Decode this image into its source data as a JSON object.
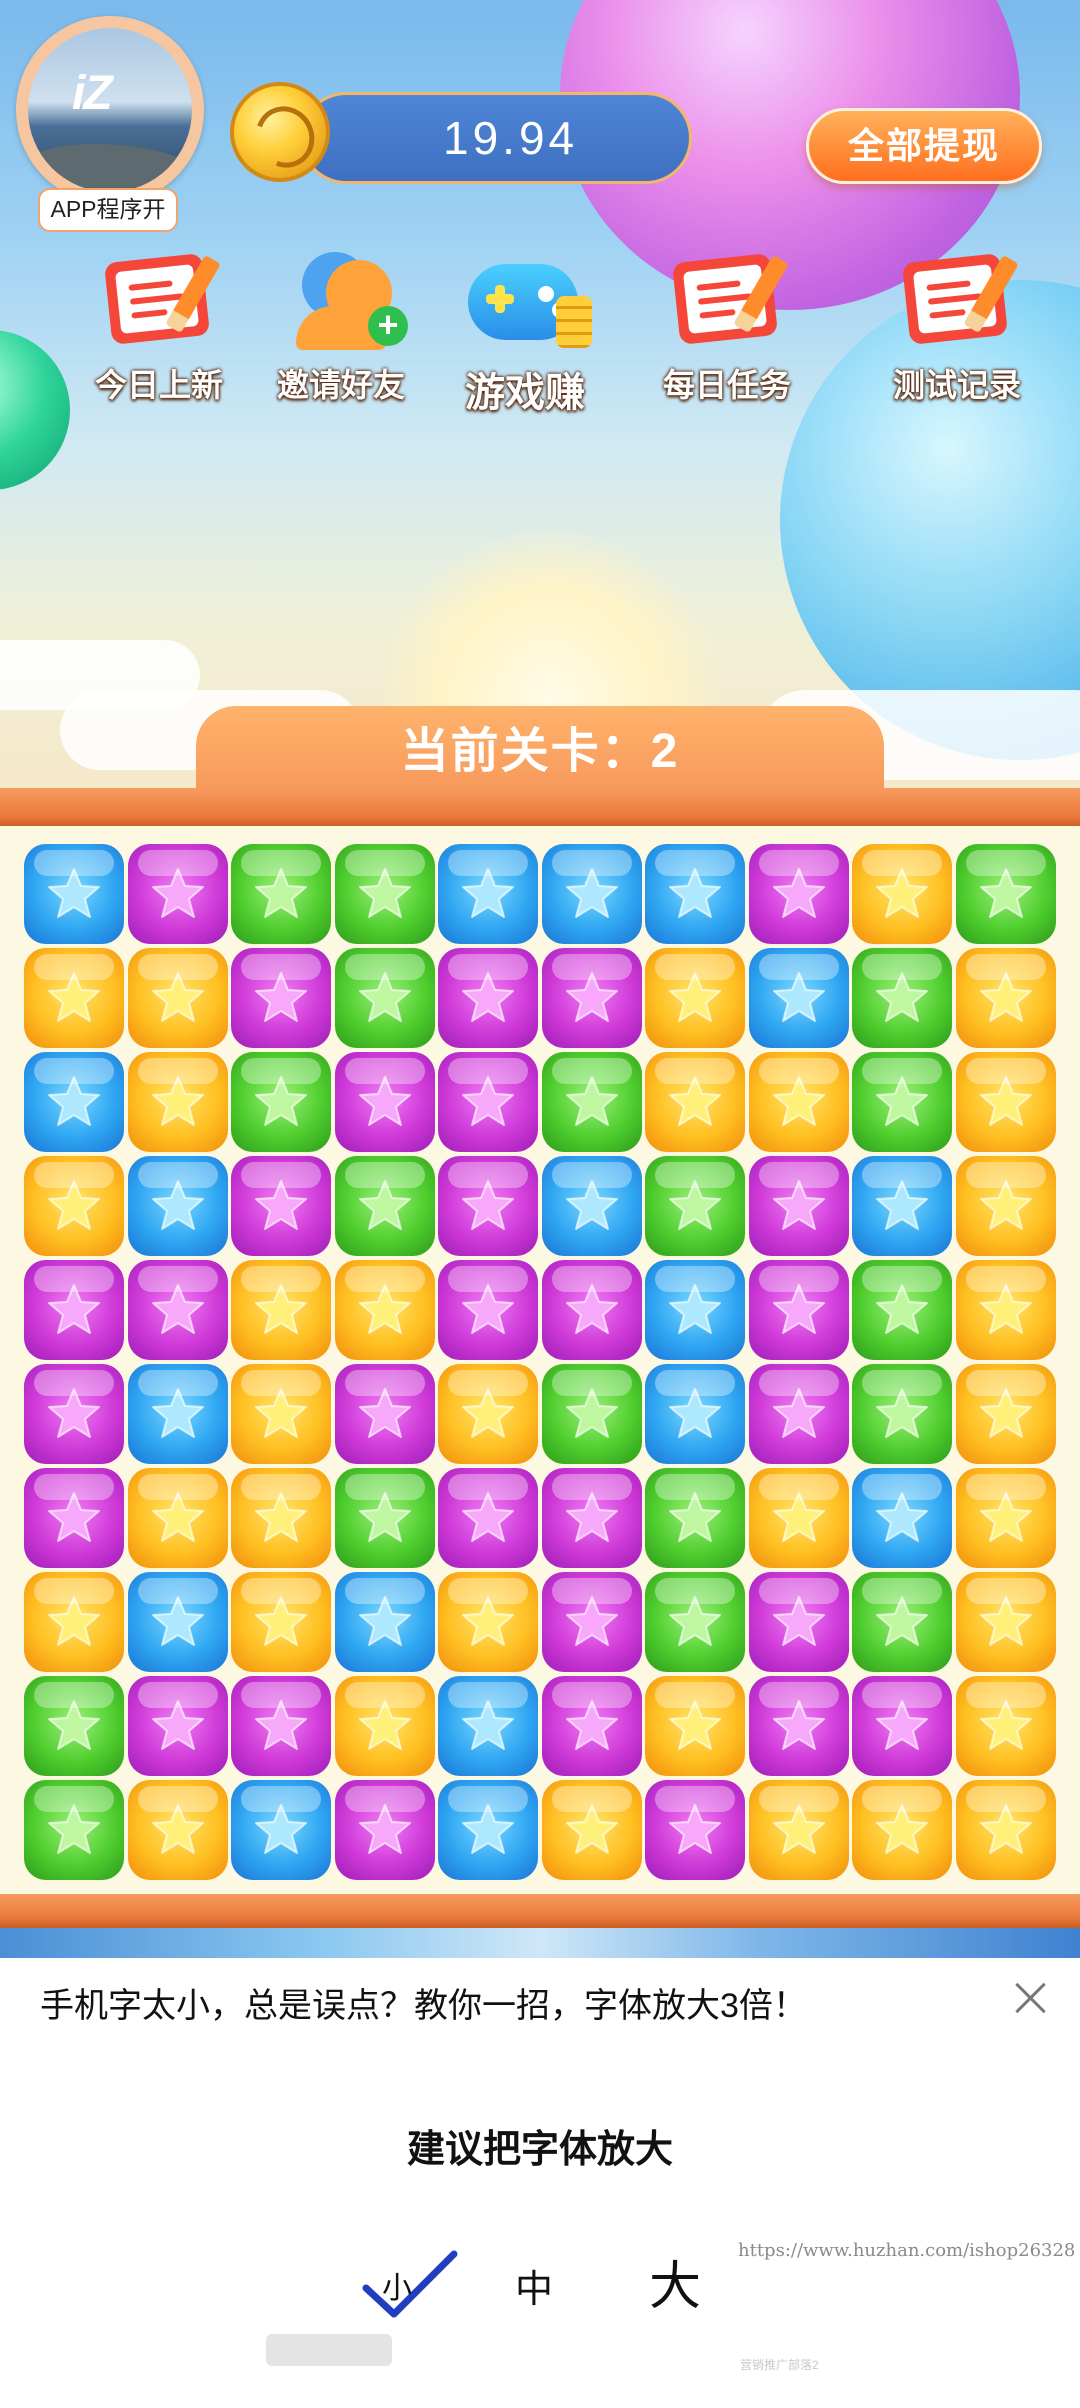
{
  "header": {
    "avatar_badge": "APP程序开",
    "avatar_logo": "iZ",
    "balance": "19.94",
    "withdraw_label": "全部提现"
  },
  "menu": [
    {
      "label": "今日上新",
      "icon": "notepad-pencil-icon"
    },
    {
      "label": "邀请好友",
      "icon": "add-user-icon"
    },
    {
      "label": "游戏赚",
      "icon": "gamepad-coins-icon"
    },
    {
      "label": "每日任务",
      "icon": "notepad-pencil-icon"
    },
    {
      "label": "测试记录",
      "icon": "notepad-pencil-icon"
    }
  ],
  "level": {
    "text": "当前关卡：2"
  },
  "board": {
    "rows": [
      [
        "B",
        "P",
        "G",
        "G",
        "B",
        "B",
        "B",
        "P",
        "Y",
        "G"
      ],
      [
        "Y",
        "Y",
        "P",
        "G",
        "P",
        "P",
        "Y",
        "B",
        "G",
        "Y"
      ],
      [
        "B",
        "Y",
        "G",
        "P",
        "P",
        "G",
        "Y",
        "Y",
        "G",
        "Y"
      ],
      [
        "Y",
        "B",
        "P",
        "G",
        "P",
        "B",
        "G",
        "P",
        "B",
        "Y"
      ],
      [
        "P",
        "P",
        "Y",
        "Y",
        "P",
        "P",
        "B",
        "P",
        "G",
        "Y"
      ],
      [
        "P",
        "B",
        "Y",
        "P",
        "Y",
        "G",
        "B",
        "P",
        "G",
        "Y"
      ],
      [
        "P",
        "Y",
        "Y",
        "G",
        "P",
        "P",
        "G",
        "Y",
        "B",
        "Y"
      ],
      [
        "Y",
        "B",
        "Y",
        "B",
        "Y",
        "P",
        "G",
        "P",
        "G",
        "Y"
      ],
      [
        "G",
        "P",
        "P",
        "Y",
        "B",
        "P",
        "Y",
        "P",
        "P",
        "Y"
      ],
      [
        "G",
        "Y",
        "B",
        "P",
        "B",
        "Y",
        "P",
        "Y",
        "Y",
        "Y"
      ]
    ],
    "legend": {
      "B": "blue",
      "P": "purple",
      "G": "green",
      "Y": "yellow"
    }
  },
  "font_sheet": {
    "title": "手机字太小，总是误点？教你一招，字体放大3倍！",
    "subtitle": "建议把字体放大",
    "option_small": "小",
    "option_medium": "中",
    "option_large": "大",
    "selected": "小",
    "watermark": "https://www.huzhan.com/ishop26328",
    "watermark_small": "营销推广部落2"
  },
  "colors": {
    "accent_orange": "#f7975a",
    "withdraw_orange": "#ff6f1f",
    "balance_blue": "#3f6fc1",
    "check_blue": "#1f3fbf"
  }
}
